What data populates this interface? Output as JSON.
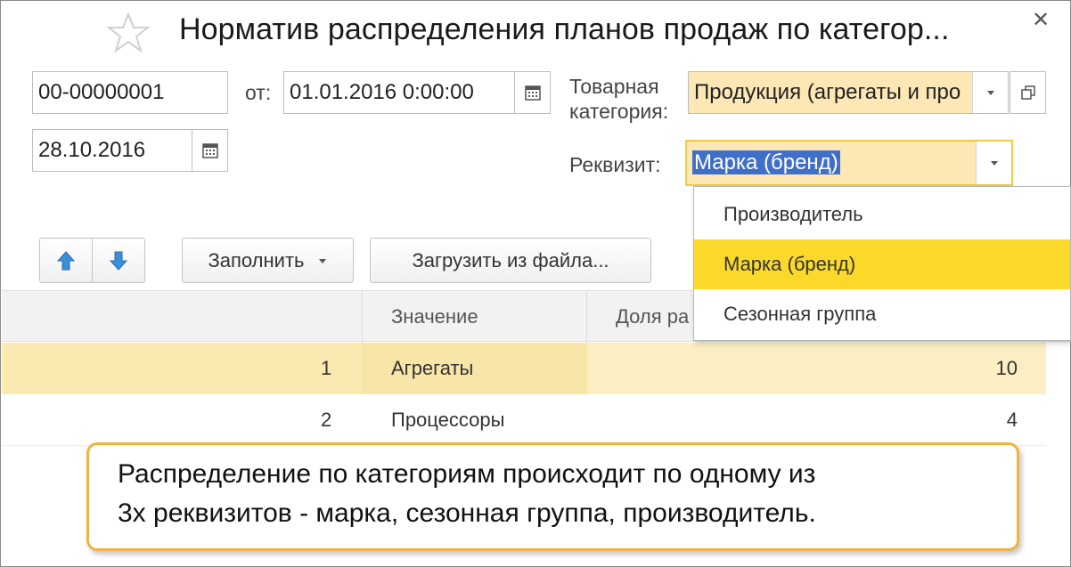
{
  "window": {
    "title": "Норматив распределения планов продаж по категор...",
    "close_glyph": "✕"
  },
  "form": {
    "number": "00-00000001",
    "date_prefix": "от:",
    "datetime": "01.01.2016  0:00:00",
    "date2": "28.10.2016",
    "category_label_line1": "Товарная",
    "category_label_line2": "категория:",
    "category_value": "Продукция (агрегаты и про",
    "attribute_label": "Реквизит:",
    "attribute_value": "Марка (бренд)"
  },
  "toolbar": {
    "fill_label": "Заполнить",
    "load_label": "Загрузить из файла..."
  },
  "table": {
    "headers": [
      "Значение",
      "Доля ра"
    ],
    "rows": [
      {
        "num": "1",
        "value": "Агрегаты",
        "share": "10"
      },
      {
        "num": "2",
        "value": "Процессоры",
        "share": "4"
      }
    ]
  },
  "dropdown": {
    "items": [
      "Производитель",
      "Марка (бренд)",
      "Сезонная группа"
    ],
    "selected_index": 1
  },
  "callout": {
    "line1": "Распределение по категориям происходит по одному из",
    "line2": "3х реквизитов - марка, сезонная группа, производитель."
  },
  "colors": {
    "highlight_yellow": "#fad92a",
    "field_yellow": "#fde8b5",
    "row_selected": "#faeec2",
    "callout_border": "#f3b23b",
    "arrow_blue": "#3a8fd9"
  }
}
